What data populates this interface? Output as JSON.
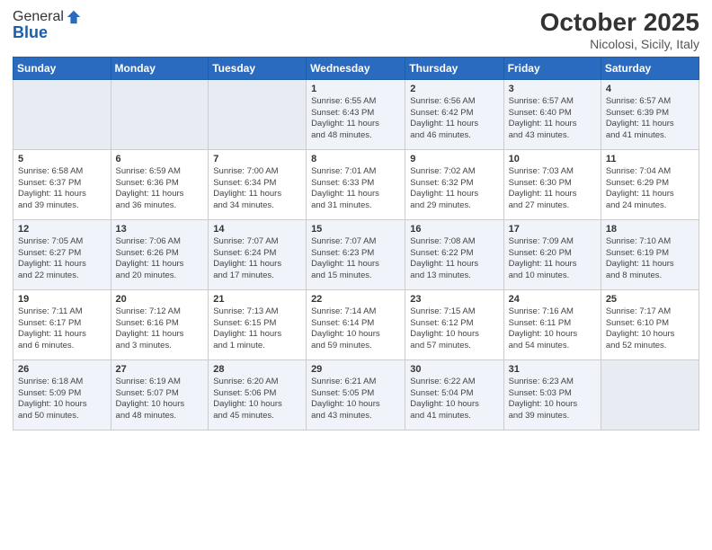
{
  "header": {
    "logo_general": "General",
    "logo_blue": "Blue",
    "month": "October 2025",
    "location": "Nicolosi, Sicily, Italy"
  },
  "days_of_week": [
    "Sunday",
    "Monday",
    "Tuesday",
    "Wednesday",
    "Thursday",
    "Friday",
    "Saturday"
  ],
  "weeks": [
    [
      {
        "day": "",
        "info": ""
      },
      {
        "day": "",
        "info": ""
      },
      {
        "day": "",
        "info": ""
      },
      {
        "day": "1",
        "info": "Sunrise: 6:55 AM\nSunset: 6:43 PM\nDaylight: 11 hours\nand 48 minutes."
      },
      {
        "day": "2",
        "info": "Sunrise: 6:56 AM\nSunset: 6:42 PM\nDaylight: 11 hours\nand 46 minutes."
      },
      {
        "day": "3",
        "info": "Sunrise: 6:57 AM\nSunset: 6:40 PM\nDaylight: 11 hours\nand 43 minutes."
      },
      {
        "day": "4",
        "info": "Sunrise: 6:57 AM\nSunset: 6:39 PM\nDaylight: 11 hours\nand 41 minutes."
      }
    ],
    [
      {
        "day": "5",
        "info": "Sunrise: 6:58 AM\nSunset: 6:37 PM\nDaylight: 11 hours\nand 39 minutes."
      },
      {
        "day": "6",
        "info": "Sunrise: 6:59 AM\nSunset: 6:36 PM\nDaylight: 11 hours\nand 36 minutes."
      },
      {
        "day": "7",
        "info": "Sunrise: 7:00 AM\nSunset: 6:34 PM\nDaylight: 11 hours\nand 34 minutes."
      },
      {
        "day": "8",
        "info": "Sunrise: 7:01 AM\nSunset: 6:33 PM\nDaylight: 11 hours\nand 31 minutes."
      },
      {
        "day": "9",
        "info": "Sunrise: 7:02 AM\nSunset: 6:32 PM\nDaylight: 11 hours\nand 29 minutes."
      },
      {
        "day": "10",
        "info": "Sunrise: 7:03 AM\nSunset: 6:30 PM\nDaylight: 11 hours\nand 27 minutes."
      },
      {
        "day": "11",
        "info": "Sunrise: 7:04 AM\nSunset: 6:29 PM\nDaylight: 11 hours\nand 24 minutes."
      }
    ],
    [
      {
        "day": "12",
        "info": "Sunrise: 7:05 AM\nSunset: 6:27 PM\nDaylight: 11 hours\nand 22 minutes."
      },
      {
        "day": "13",
        "info": "Sunrise: 7:06 AM\nSunset: 6:26 PM\nDaylight: 11 hours\nand 20 minutes."
      },
      {
        "day": "14",
        "info": "Sunrise: 7:07 AM\nSunset: 6:24 PM\nDaylight: 11 hours\nand 17 minutes."
      },
      {
        "day": "15",
        "info": "Sunrise: 7:07 AM\nSunset: 6:23 PM\nDaylight: 11 hours\nand 15 minutes."
      },
      {
        "day": "16",
        "info": "Sunrise: 7:08 AM\nSunset: 6:22 PM\nDaylight: 11 hours\nand 13 minutes."
      },
      {
        "day": "17",
        "info": "Sunrise: 7:09 AM\nSunset: 6:20 PM\nDaylight: 11 hours\nand 10 minutes."
      },
      {
        "day": "18",
        "info": "Sunrise: 7:10 AM\nSunset: 6:19 PM\nDaylight: 11 hours\nand 8 minutes."
      }
    ],
    [
      {
        "day": "19",
        "info": "Sunrise: 7:11 AM\nSunset: 6:17 PM\nDaylight: 11 hours\nand 6 minutes."
      },
      {
        "day": "20",
        "info": "Sunrise: 7:12 AM\nSunset: 6:16 PM\nDaylight: 11 hours\nand 3 minutes."
      },
      {
        "day": "21",
        "info": "Sunrise: 7:13 AM\nSunset: 6:15 PM\nDaylight: 11 hours\nand 1 minute."
      },
      {
        "day": "22",
        "info": "Sunrise: 7:14 AM\nSunset: 6:14 PM\nDaylight: 10 hours\nand 59 minutes."
      },
      {
        "day": "23",
        "info": "Sunrise: 7:15 AM\nSunset: 6:12 PM\nDaylight: 10 hours\nand 57 minutes."
      },
      {
        "day": "24",
        "info": "Sunrise: 7:16 AM\nSunset: 6:11 PM\nDaylight: 10 hours\nand 54 minutes."
      },
      {
        "day": "25",
        "info": "Sunrise: 7:17 AM\nSunset: 6:10 PM\nDaylight: 10 hours\nand 52 minutes."
      }
    ],
    [
      {
        "day": "26",
        "info": "Sunrise: 6:18 AM\nSunset: 5:09 PM\nDaylight: 10 hours\nand 50 minutes."
      },
      {
        "day": "27",
        "info": "Sunrise: 6:19 AM\nSunset: 5:07 PM\nDaylight: 10 hours\nand 48 minutes."
      },
      {
        "day": "28",
        "info": "Sunrise: 6:20 AM\nSunset: 5:06 PM\nDaylight: 10 hours\nand 45 minutes."
      },
      {
        "day": "29",
        "info": "Sunrise: 6:21 AM\nSunset: 5:05 PM\nDaylight: 10 hours\nand 43 minutes."
      },
      {
        "day": "30",
        "info": "Sunrise: 6:22 AM\nSunset: 5:04 PM\nDaylight: 10 hours\nand 41 minutes."
      },
      {
        "day": "31",
        "info": "Sunrise: 6:23 AM\nSunset: 5:03 PM\nDaylight: 10 hours\nand 39 minutes."
      },
      {
        "day": "",
        "info": ""
      }
    ]
  ]
}
